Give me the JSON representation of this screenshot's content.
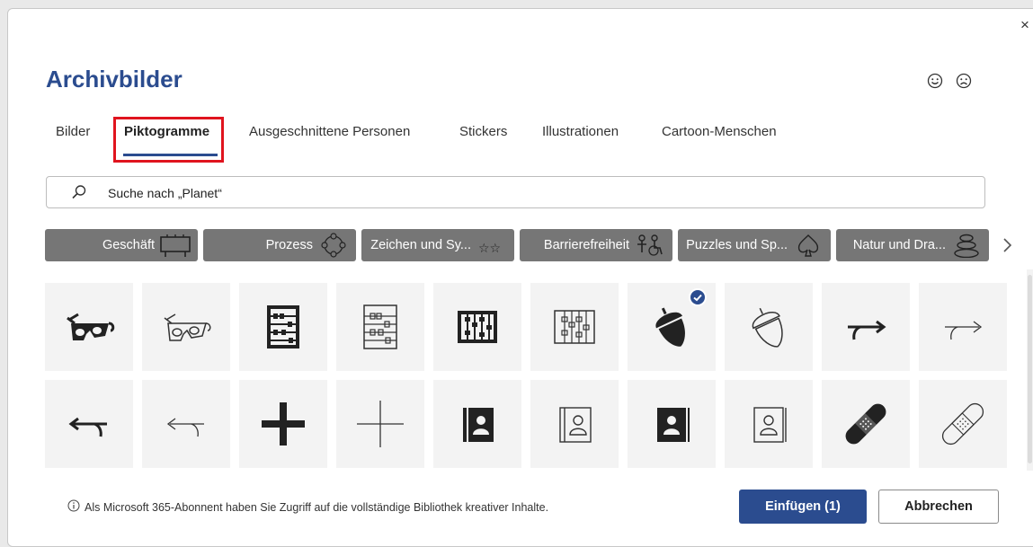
{
  "dialog": {
    "title": "Archivbilder",
    "close_glyph": "×",
    "feedback_icons": [
      "smile-face-icon",
      "frown-face-icon"
    ],
    "accent_color": "#2b4c8f",
    "highlight_color": "#e0141e"
  },
  "tabs": [
    {
      "label": "Bilder",
      "active": false
    },
    {
      "label": "Piktogramme",
      "active": true
    },
    {
      "label": "Ausgeschnittene Personen",
      "active": false
    },
    {
      "label": "Stickers",
      "active": false
    },
    {
      "label": "Illustrationen",
      "active": false
    },
    {
      "label": "Cartoon-Menschen",
      "active": false
    }
  ],
  "search": {
    "value": "Suche nach „Planet“",
    "icon": "search-icon"
  },
  "categories": [
    {
      "label": "Geschäft",
      "icon": "billboard-icon"
    },
    {
      "label": "Prozess",
      "icon": "cycle-icon"
    },
    {
      "label": "Zeichen und Sy...",
      "icon": "stars-icon"
    },
    {
      "label": "Barrierefreiheit",
      "icon": "accessibility-people-icon"
    },
    {
      "label": "Puzzles und Sp...",
      "icon": "spade-icon"
    },
    {
      "label": "Natur und Dra...",
      "icon": "stacked-stones-icon"
    }
  ],
  "icons_grid": [
    {
      "name": "3d-glasses-filled-icon",
      "selected": false
    },
    {
      "name": "3d-glasses-outline-icon",
      "selected": false
    },
    {
      "name": "abacus-filled-icon",
      "selected": false
    },
    {
      "name": "abacus-outline-icon",
      "selected": false
    },
    {
      "name": "abacus-vertical-filled-icon",
      "selected": false
    },
    {
      "name": "abacus-vertical-outline-icon",
      "selected": false
    },
    {
      "name": "acorn-filled-icon",
      "selected": true
    },
    {
      "name": "acorn-outline-icon",
      "selected": false
    },
    {
      "name": "arrow-right-curve-filled-icon",
      "selected": false
    },
    {
      "name": "arrow-right-curve-outline-icon",
      "selected": false
    },
    {
      "name": "arrow-left-curve-filled-icon",
      "selected": false
    },
    {
      "name": "arrow-left-curve-outline-icon",
      "selected": false
    },
    {
      "name": "plus-filled-icon",
      "selected": false
    },
    {
      "name": "plus-outline-icon",
      "selected": false
    },
    {
      "name": "address-book-filled-icon",
      "selected": false
    },
    {
      "name": "address-book-outline-icon",
      "selected": false
    },
    {
      "name": "contact-book-filled-icon",
      "selected": false
    },
    {
      "name": "contact-book-outline-icon",
      "selected": false
    },
    {
      "name": "bandage-filled-icon",
      "selected": false
    },
    {
      "name": "bandage-outline-icon",
      "selected": false
    }
  ],
  "footer": {
    "info_icon": "info-icon",
    "text": "Als Microsoft 365-Abonnent haben Sie Zugriff auf die vollständige Bibliothek kreativer Inhalte.",
    "insert_label": "Einfügen (1)",
    "cancel_label": "Abbrechen"
  }
}
